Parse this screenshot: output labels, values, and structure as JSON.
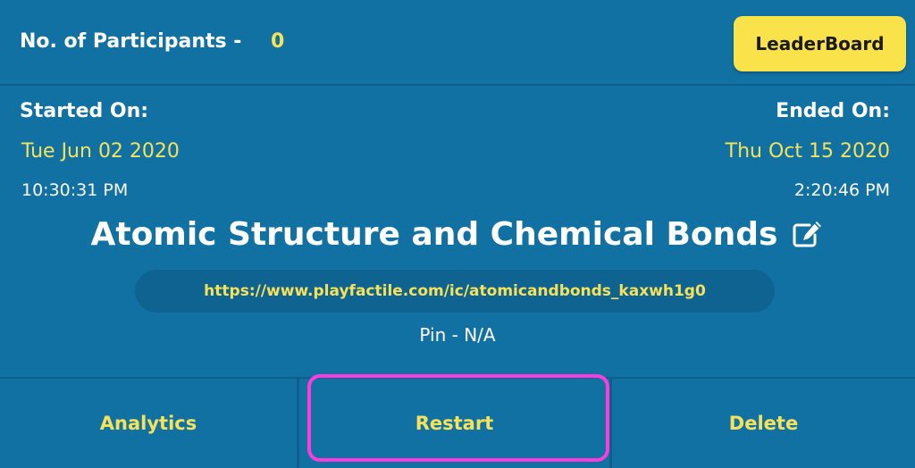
{
  "header": {
    "participants_label": "No. of Participants -",
    "participants_count": "0",
    "leaderboard_label": "LeaderBoard"
  },
  "schedule": {
    "started_label": "Started On:",
    "started_date": "Tue Jun 02 2020",
    "started_time": "10:30:31 PM",
    "ended_label": "Ended On:",
    "ended_date": "Thu Oct 15 2020",
    "ended_time": "2:20:46 PM"
  },
  "game": {
    "title": "Atomic Structure and Chemical Bonds",
    "edit_icon": "edit-icon",
    "url": "https://www.playfactile.com/ic/atomicandbonds_kaxwh1g0",
    "pin": "Pin - N/A"
  },
  "actions": {
    "analytics_label": "Analytics",
    "restart_label": "Restart",
    "delete_label": "Delete"
  },
  "colors": {
    "background": "#1271a3",
    "accent_yellow": "#f5e25a",
    "button_yellow": "#f9e24a",
    "highlight": "#ff3bdc"
  }
}
